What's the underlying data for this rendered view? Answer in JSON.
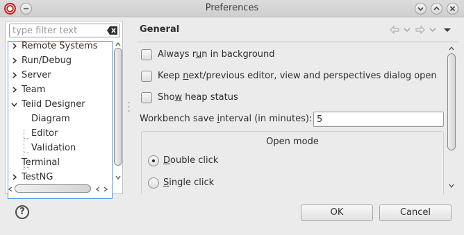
{
  "window": {
    "title": "Preferences"
  },
  "filter": {
    "placeholder": "type filter text"
  },
  "tree": {
    "items": [
      {
        "label": "Remote Systems"
      },
      {
        "label": "Run/Debug"
      },
      {
        "label": "Server"
      },
      {
        "label": "Team"
      },
      {
        "label": "Teiid Designer"
      },
      {
        "label": "Diagram"
      },
      {
        "label": "Editor"
      },
      {
        "label": "Validation"
      },
      {
        "label": "Terminal"
      },
      {
        "label": "TestNG"
      }
    ]
  },
  "page": {
    "title": "General",
    "always_run_pre": "Always r",
    "always_run_u": "u",
    "always_run_post": "n in background",
    "keep_next_pre": "Keep ",
    "keep_next_u": "n",
    "keep_next_post": "ext/previous editor, view and perspectives dialog open",
    "show_heap_pre": "Sho",
    "show_heap_u": "w",
    "show_heap_post": " heap status",
    "interval_pre": "Workbench save ",
    "interval_u": "i",
    "interval_post": "nterval (in minutes):",
    "interval_value": "5",
    "open_mode": {
      "title": "Open mode",
      "double_u": "D",
      "double_post": "ouble click",
      "single_u": "S",
      "single_post": "ingle click",
      "selected": "double"
    }
  },
  "buttons": {
    "help": "?",
    "ok": "OK",
    "cancel": "Cancel"
  },
  "colors": {
    "selection_border": "#4c9be8",
    "background": "#ebebeb"
  }
}
